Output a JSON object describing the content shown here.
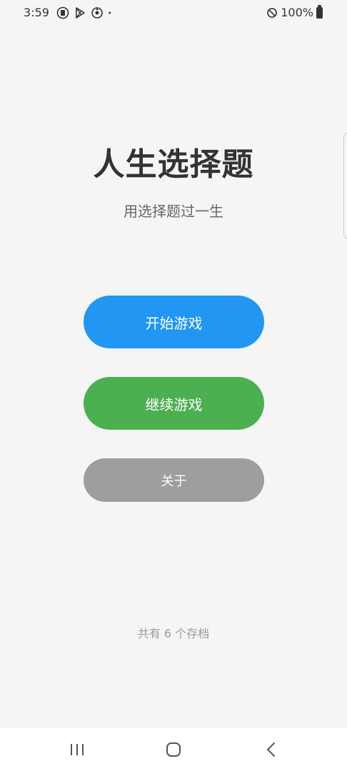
{
  "status_bar": {
    "time": "3:59",
    "battery_text": "100%",
    "icons": [
      "notification-icon",
      "play-store-icon",
      "settings-sync-icon",
      "dot-icon",
      "do-not-disturb-icon",
      "battery-icon"
    ]
  },
  "main": {
    "title": "人生选择题",
    "subtitle": "用选择题过一生",
    "buttons": {
      "start": "开始游戏",
      "continue": "继续游戏",
      "about": "关于"
    },
    "save_count": "共有 6 个存档"
  },
  "nav_bar": {
    "icons": [
      "recent-apps-icon",
      "home-icon",
      "back-icon"
    ]
  },
  "colors": {
    "background": "#f5f5f5",
    "start_button": "#2196f3",
    "continue_button": "#4caf50",
    "about_button": "#9e9e9e"
  }
}
